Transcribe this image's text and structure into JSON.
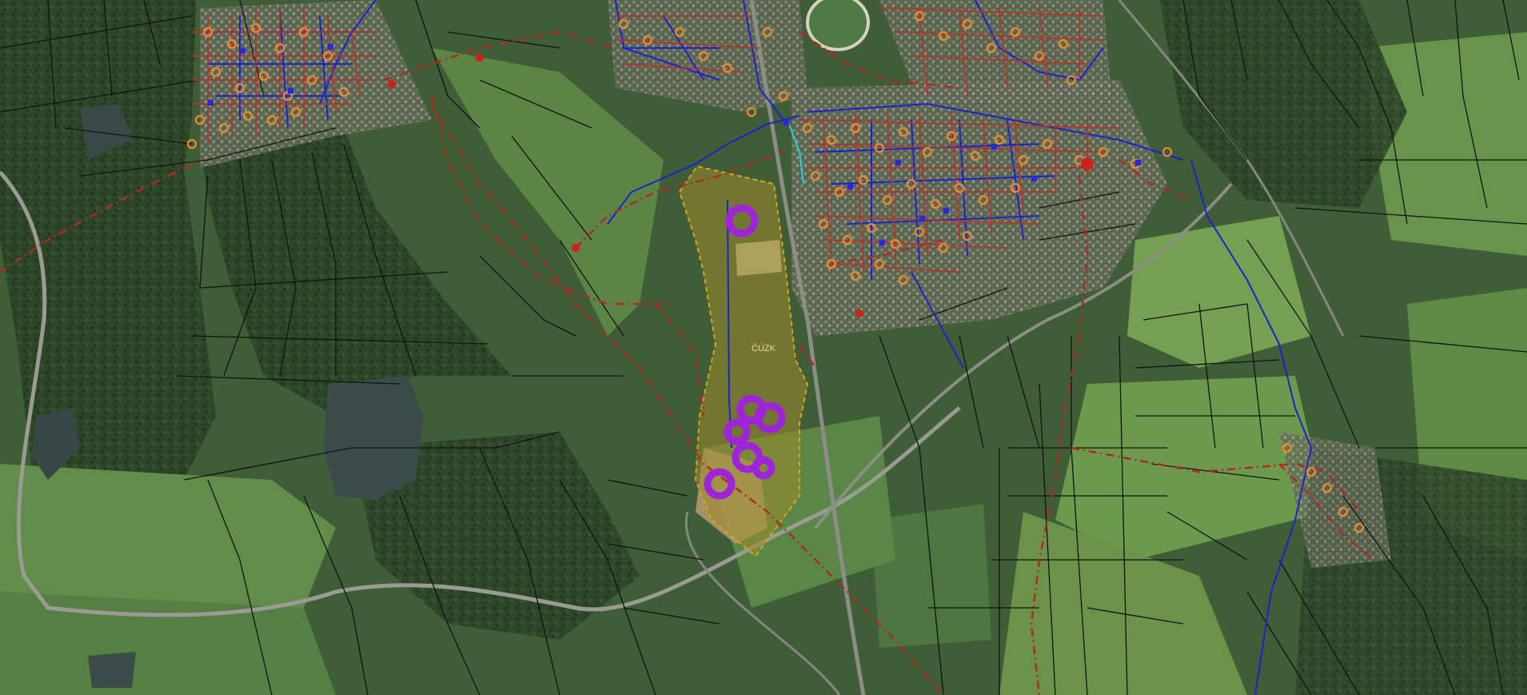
{
  "map": {
    "type": "cadastral-aerial-overlay",
    "labels": {
      "area_label": "ČÚZK"
    },
    "colors": {
      "aerial_base": "#3c5a34",
      "forest": "#2c4427",
      "meadow": "#5f8a4a",
      "field": "#73994f",
      "water": "#3d4c4a",
      "urban": "#6e7468",
      "parcel_line": "#141414",
      "gas_line_red": "#b22a22",
      "water_line_blue": "#1d22c8",
      "utility_point_orange": "#f28a2e",
      "highlight_area_fill": "#a08a2a",
      "highlight_area_stroke": "#d8a21a",
      "cluster_purple": "#a023dc",
      "cyan_line": "#22d0d8"
    },
    "layers": {
      "cadastral_parcels": "visible",
      "red_dashed_utility_network": "visible",
      "blue_water_network": "visible",
      "orange_utility_points": "visible",
      "purple_point_clusters": "visible",
      "highlighted_parcel_area": "visible"
    }
  }
}
